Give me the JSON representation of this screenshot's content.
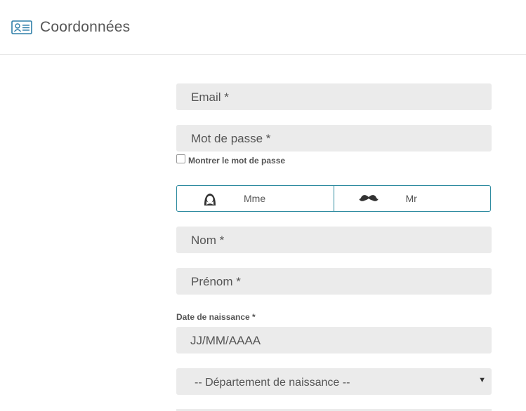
{
  "header": {
    "title": "Coordonnées",
    "icon": "contact-card-icon"
  },
  "form": {
    "email_placeholder": "Email *",
    "password_placeholder": "Mot de passe *",
    "show_password_label": "Montrer le mot de passe",
    "gender": {
      "female_label": "Mme",
      "female_icon": "woman-icon",
      "male_label": "Mr",
      "male_icon": "mustache-icon"
    },
    "lastname_placeholder": "Nom *",
    "firstname_placeholder": "Prénom *",
    "birthdate_label": "Date de naissance *",
    "birthdate_placeholder": "JJ/MM/AAAA",
    "birth_department_selected": "-- Département de naissance --"
  },
  "colors": {
    "accent": "#2e8ba0",
    "field_bg": "#ebebeb",
    "text": "#555555"
  }
}
